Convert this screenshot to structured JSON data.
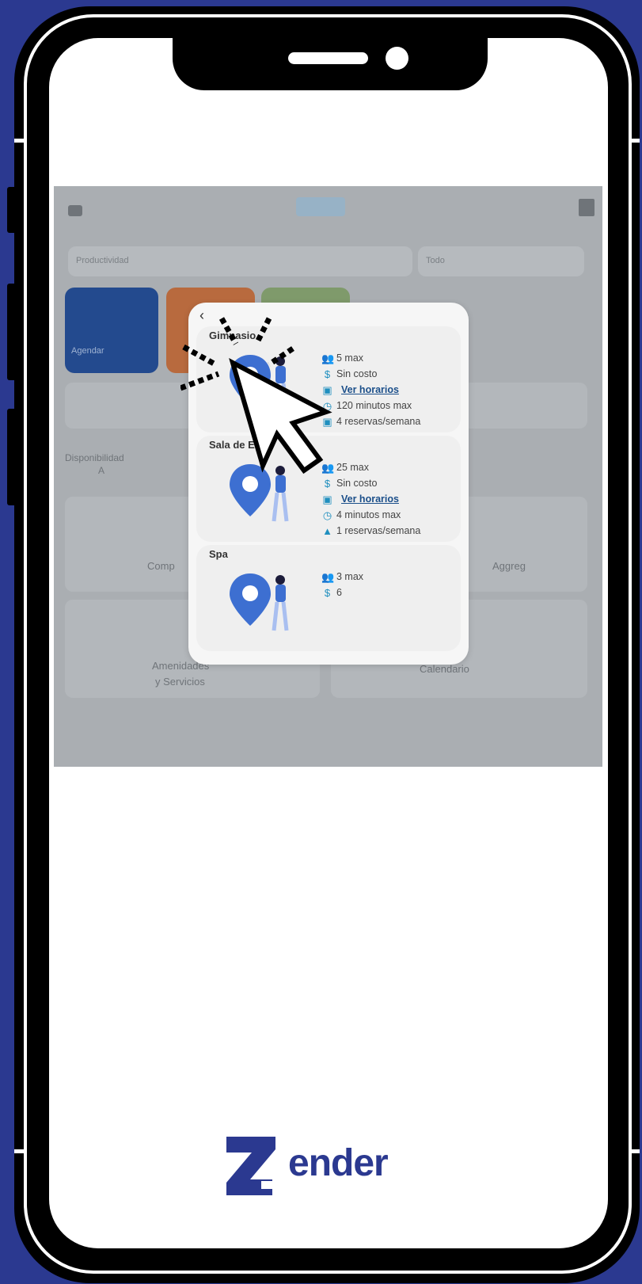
{
  "modal": {
    "back_label": "‹",
    "venues": [
      {
        "name": "Gimnasio",
        "capacity": "5 max",
        "cost": "Sin costo",
        "schedule_link": "Ver horarios",
        "duration": "120 minutos max",
        "reservations": "4 reservas/semana"
      },
      {
        "name": "Sala de E",
        "capacity": "25 max",
        "cost": "Sin costo",
        "schedule_link": "Ver horarios",
        "duration": "4 minutos max",
        "reservations": "1 reservas/semana"
      },
      {
        "name": "Spa",
        "capacity": "3 max",
        "cost": "6"
      }
    ]
  },
  "brand": {
    "letter": "Z",
    "word": "ender",
    "color": "#2b3990"
  },
  "background_text": {
    "select_left": "Productividad",
    "select_right": "Todo",
    "tile_1": "Agendar",
    "section_1": "Disponibilidad",
    "section_2": "A",
    "card_1": "Comp",
    "card_2": "Aggreg",
    "card_3a": "Amenidades",
    "card_3b": "y Servicios",
    "card_4": "Calendario"
  },
  "colors": {
    "frame_background": "#2b3990",
    "accent_icon": "#1f8fbf",
    "pin": "#3d6fd1"
  }
}
